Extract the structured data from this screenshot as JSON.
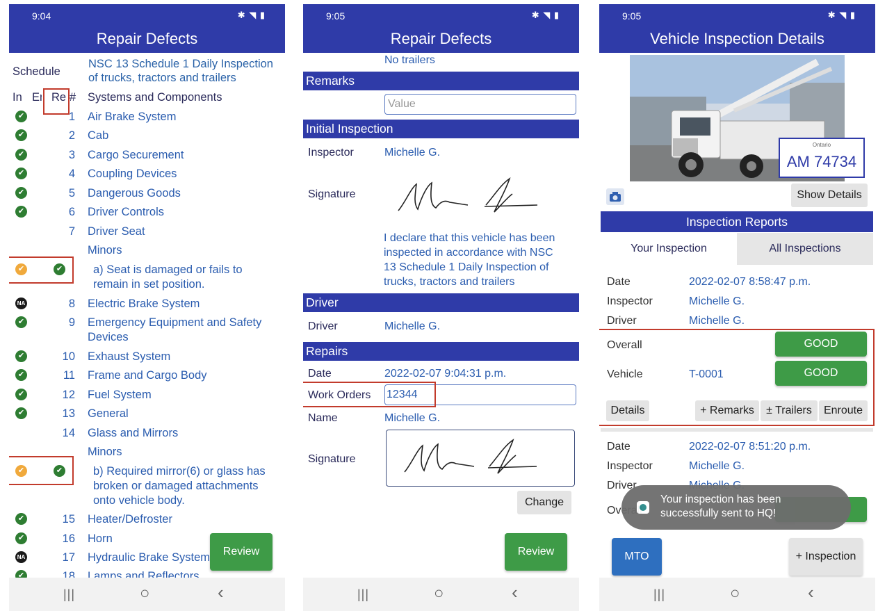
{
  "phone1": {
    "status_time": "9:04",
    "title": "Repair Defects",
    "schedule_label": "Schedule",
    "schedule_name": "NSC 13 Schedule 1 Daily Inspection of trucks, tractors and trailers",
    "col_in": "In",
    "col_en": "En",
    "col_re": "Re",
    "col_num": "#",
    "col_systems": "Systems and Components",
    "items": [
      {
        "num": "1",
        "label": "Air Brake System"
      },
      {
        "num": "2",
        "label": "Cab"
      },
      {
        "num": "3",
        "label": "Cargo Securement"
      },
      {
        "num": "4",
        "label": "Coupling Devices"
      },
      {
        "num": "5",
        "label": "Dangerous Goods"
      },
      {
        "num": "6",
        "label": "Driver Controls"
      },
      {
        "num": "7",
        "label": "Driver Seat"
      },
      {
        "num": "8",
        "label": "Electric Brake System"
      },
      {
        "num": "9",
        "label": "Emergency Equipment and Safety Devices"
      },
      {
        "num": "10",
        "label": "Exhaust System"
      },
      {
        "num": "11",
        "label": "Frame and Cargo Body"
      },
      {
        "num": "12",
        "label": "Fuel System"
      },
      {
        "num": "13",
        "label": "General"
      },
      {
        "num": "14",
        "label": "Glass and Mirrors"
      },
      {
        "num": "15",
        "label": "Heater/Defroster"
      },
      {
        "num": "16",
        "label": "Horn"
      },
      {
        "num": "17",
        "label": "Hydraulic Brake System"
      },
      {
        "num": "18",
        "label": "Lamps and Reflectors"
      }
    ],
    "minors_label": "Minors",
    "defect_a_line1": "a) Seat is damaged or fails to",
    "defect_a_line2": "remain in set position.",
    "defect_b_line1": "b) Required mirror(6) or glass has",
    "defect_b_line2": "broken or damaged attachments",
    "defect_b_line3": "onto vehicle body.",
    "na_badge": "NA",
    "review_button": "Review"
  },
  "phone2": {
    "status_time": "9:05",
    "title": "Repair Defects",
    "trailers_text": "No trailers",
    "remarks_header": "Remarks",
    "remarks_placeholder": "Value",
    "initial_header": "Initial Inspection",
    "inspector_label": "Inspector",
    "inspector_value": "Michelle G.",
    "signature_label": "Signature",
    "declaration_1": "I declare that this vehicle has been",
    "declaration_2": "inspected in accordance with NSC",
    "declaration_3": "13 Schedule 1 Daily Inspection of",
    "declaration_4": "trucks, tractors and trailers",
    "driver_header": "Driver",
    "driver_label": "Driver",
    "driver_value": "Michelle G.",
    "repairs_header": "Repairs",
    "date_label": "Date",
    "date_value": "2022-02-07 9:04:31 p.m.",
    "work_orders_label": "Work Orders",
    "work_orders_value": "12344",
    "name_label": "Name",
    "name_value": "Michelle G.",
    "signature2_label": "Signature",
    "change_button": "Change",
    "review_button": "Review"
  },
  "phone3": {
    "status_time": "9:05",
    "title": "Vehicle Inspection Details",
    "plate_province": "Ontario",
    "plate_number": "AM 74734",
    "show_details_button": "Show Details",
    "reports_header": "Inspection Reports",
    "tab_yours": "Your Inspection",
    "tab_all": "All Inspections",
    "report1": {
      "date_label": "Date",
      "date_value": "2022-02-07 8:58:47 p.m.",
      "inspector_label": "Inspector",
      "inspector_value": "Michelle G.",
      "driver_label": "Driver",
      "driver_value": "Michelle G.",
      "overall_label": "Overall",
      "overall_status": "GOOD",
      "vehicle_label": "Vehicle",
      "vehicle_value": "T-0001",
      "vehicle_status": "GOOD"
    },
    "details_button": "Details",
    "remarks_button": "+ Remarks",
    "trailers_button": "± Trailers",
    "enroute_button": "Enroute",
    "report2": {
      "date_label": "Date",
      "date_value": "2022-02-07 8:51:20 p.m.",
      "inspector_label": "Inspector",
      "inspector_value": "Michelle G.",
      "driver_label": "Driver",
      "driver_value": "Michelle G.",
      "overall_label": "Overall"
    },
    "toast_line1": "Your inspection has been",
    "toast_line2": "successfully sent to HQ!",
    "mto_button": "MTO",
    "add_inspection_button": "+ Inspection"
  },
  "colors": {
    "appbar": "#2f3ba8",
    "ok_green": "#2e7d32",
    "minor_orange": "#f0a93c",
    "button_green": "#3e9b47",
    "highlight_red": "#c23b2c"
  }
}
